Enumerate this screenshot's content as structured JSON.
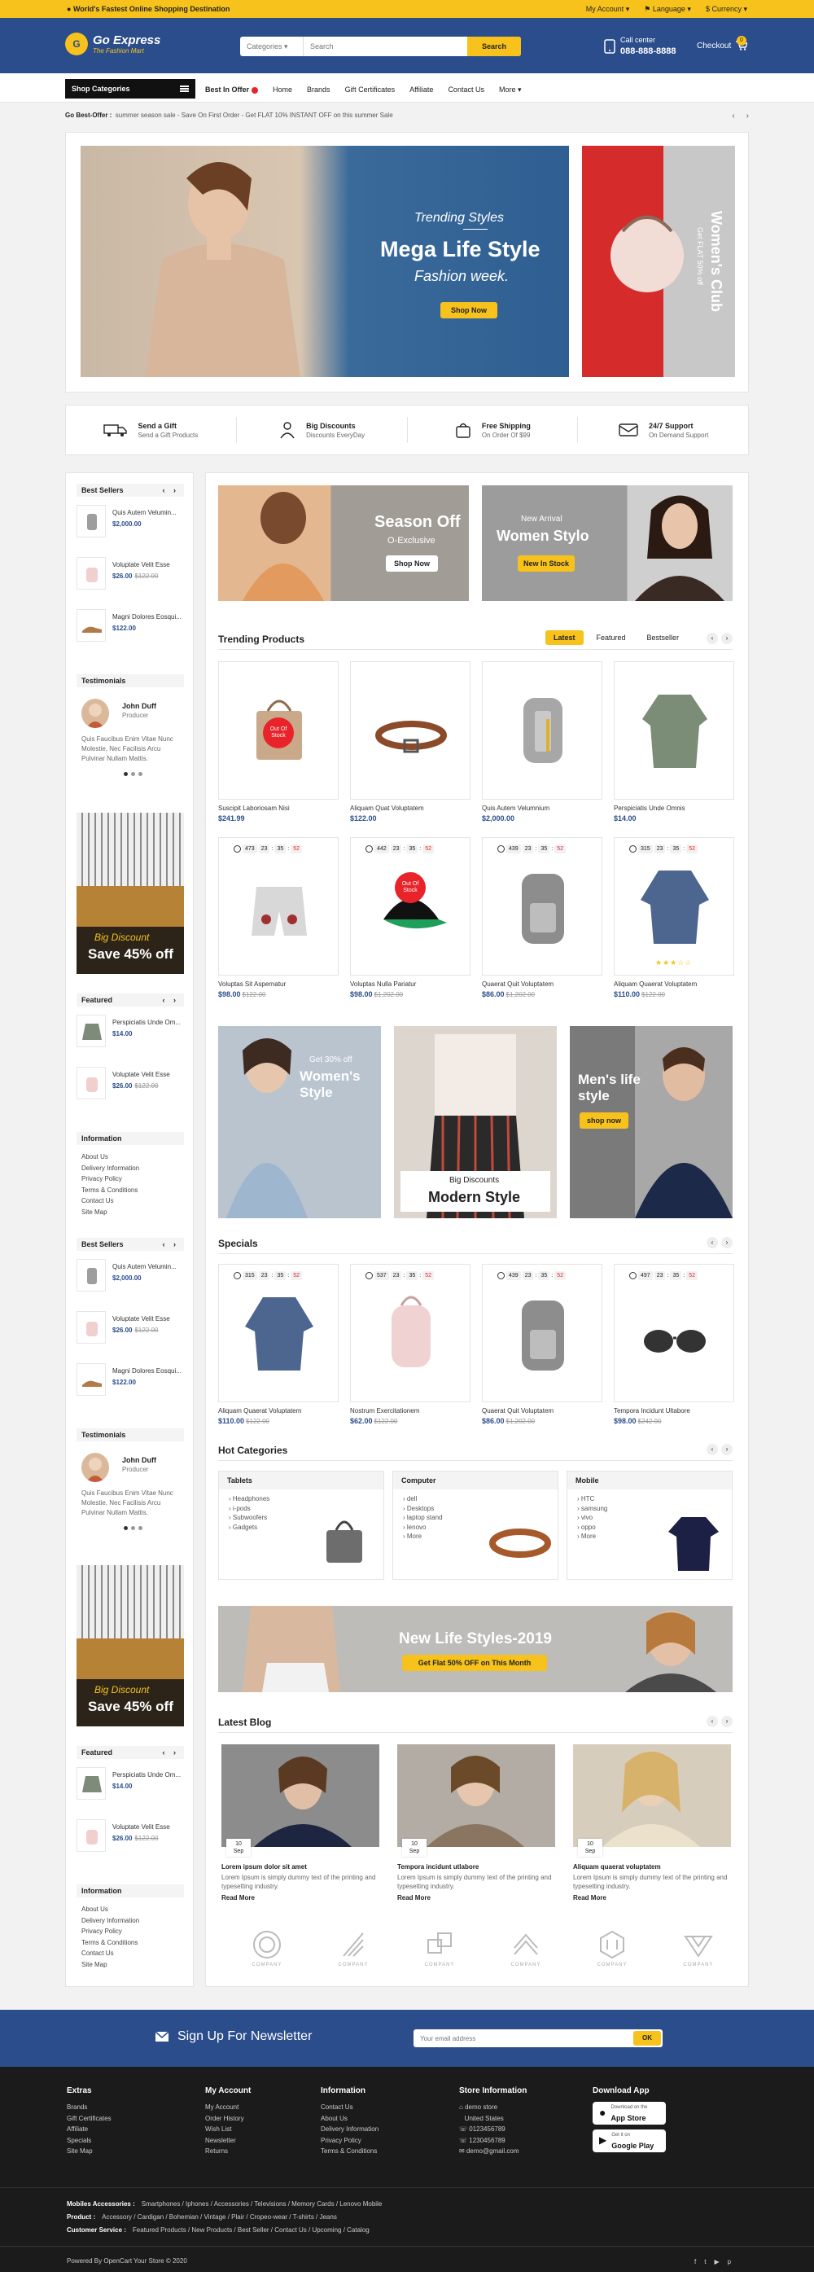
{
  "topbar": {
    "tagline": "World's Fastest Online Shopping Destination",
    "my_account": "My Account",
    "language": "Language",
    "currency": "Currency"
  },
  "header": {
    "logo_title": "Go Express",
    "logo_sub": "The Fashion Mart",
    "search_category": "Categories",
    "search_placeholder": "Search",
    "search_button": "Search",
    "call_label": "Call center",
    "call_number": "088-888-8888",
    "checkout": "Checkout",
    "cart_count": "0"
  },
  "nav": {
    "shop_categories": "Shop Categories",
    "links": [
      "Best In Offer",
      "Home",
      "Brands",
      "Gift Certificates",
      "Affiliate",
      "Contact Us",
      "More"
    ]
  },
  "offer": {
    "label": "Go Best-Offer :",
    "text": "summer season sale - Save On First Order - Get FLAT 10% INSTANT OFF on this summer Sale"
  },
  "hero": {
    "kicker": "Trending Styles",
    "title": "Mega Life Style",
    "subtitle": "Fashion week.",
    "button": "Shop Now",
    "side_title": "Women's Club",
    "side_sub": "Get FLAT 50% off"
  },
  "services": [
    {
      "title": "Send a Gift",
      "sub": "Send a Gift Products",
      "icon": "truck-icon"
    },
    {
      "title": "Big Discounts",
      "sub": "Discounts EveryDay",
      "icon": "discount-person-icon"
    },
    {
      "title": "Free Shipping",
      "sub": "On Order Of $99",
      "icon": "bag-icon"
    },
    {
      "title": "24/7 Support",
      "sub": "On Demand Support",
      "icon": "support-icon"
    }
  ],
  "sidebar": {
    "best_sellers_title": "Best Sellers",
    "best_sellers": [
      {
        "name": "Quis Autem Velumin...",
        "price": "$2,000.00",
        "old": ""
      },
      {
        "name": "Voluptate Velit Esse",
        "price": "$26.00",
        "old": "$122.00"
      },
      {
        "name": "Magni Dolores Eosqui...",
        "price": "$122.00",
        "old": ""
      }
    ],
    "testimonials_title": "Testimonials",
    "testimonial": {
      "name": "John Duff",
      "role": "Producer",
      "text": "Quis Faucibus Enim Vitae Nunc Molestie, Nec Facilisis Arcu Pulvinar Nullam Mattis."
    },
    "banner_script": "Big Discount",
    "banner_text": "Save 45% off",
    "featured_title": "Featured",
    "featured": [
      {
        "name": "Perspiciatis Unde Om...",
        "price": "$14.00",
        "old": ""
      },
      {
        "name": "Voluptate Velit Esse",
        "price": "$26.00",
        "old": "$122.00"
      }
    ],
    "information_title": "Information",
    "information": [
      "About Us",
      "Delivery Information",
      "Privacy Policy",
      "Terms & Conditions",
      "Contact Us",
      "Site Map"
    ]
  },
  "promo": {
    "season_title": "Season Off",
    "season_sub": "O-Exclusive",
    "season_btn": "Shop Now",
    "new_arrival": "New Arrival",
    "women_stylo": "Women Stylo",
    "in_stock": "New In Stock"
  },
  "trending": {
    "title": "Trending Products",
    "tabs": [
      "Latest",
      "Featured",
      "Bestseller"
    ],
    "products": [
      {
        "name": "Suscipit Laboriosam Nisi",
        "price": "$241.99",
        "old": "",
        "timer": null,
        "oos": true,
        "icon": "box-bag-icon"
      },
      {
        "name": "Aliquam Quat Voluptatem",
        "price": "$122.00",
        "old": "",
        "timer": null,
        "oos": false,
        "icon": "belt-icon"
      },
      {
        "name": "Quis Autem Velumnium",
        "price": "$2,000.00",
        "old": "",
        "timer": null,
        "oos": false,
        "icon": "backpack-icon"
      },
      {
        "name": "Perspiciatis Unde Omnis",
        "price": "$14.00",
        "old": "",
        "timer": null,
        "oos": false,
        "icon": "jacket-icon"
      },
      {
        "name": "Voluptas Sit Aspernatur",
        "price": "$98.00",
        "old": "$122.00",
        "timer": [
          "473",
          "23",
          "35",
          "52"
        ],
        "oos": false,
        "icon": "shorts-icon"
      },
      {
        "name": "Voluptas Nulla Pariatur",
        "price": "$98.00",
        "old": "$1,202.00",
        "timer": [
          "442",
          "23",
          "35",
          "52"
        ],
        "oos": true,
        "icon": "cap-icon"
      },
      {
        "name": "Quaerat Quit Voluptatem",
        "price": "$86.00",
        "old": "$1,202.00",
        "timer": [
          "439",
          "23",
          "35",
          "52"
        ],
        "oos": false,
        "icon": "backpack-icon"
      },
      {
        "name": "Aliquam Quaerat Voluptatem",
        "price": "$110.00",
        "old": "$122.00",
        "timer": [
          "315",
          "23",
          "35",
          "52"
        ],
        "oos": false,
        "icon": "sweater-icon"
      }
    ],
    "oos_label": "Out Of Stock"
  },
  "banners2": {
    "w_top": "Get 30% off",
    "w_title": "Women's Style",
    "m_small": "Big Discounts",
    "m_title": "Modern Style",
    "men_title": "Men's life style",
    "men_btn": "shop now"
  },
  "specials": {
    "title": "Specials",
    "products": [
      {
        "name": "Aliquam Quaerat Voluptatem",
        "price": "$110.00",
        "old": "$122.00",
        "timer": [
          "315",
          "23",
          "35",
          "52"
        ],
        "icon": "sweater-icon"
      },
      {
        "name": "Nostrum Exercitationem",
        "price": "$62.00",
        "old": "$122.00",
        "timer": [
          "537",
          "23",
          "35",
          "52"
        ],
        "icon": "pink-backpack-icon"
      },
      {
        "name": "Quaerat Quit Voluptatem",
        "price": "$86.00",
        "old": "$1,202.00",
        "timer": [
          "439",
          "23",
          "35",
          "52"
        ],
        "icon": "backpack-icon"
      },
      {
        "name": "Tempora Incidunt Ultabore",
        "price": "$98.00",
        "old": "$242.00",
        "timer": [
          "497",
          "23",
          "35",
          "52"
        ],
        "icon": "sunglasses-icon"
      }
    ]
  },
  "hot": {
    "title": "Hot Categories",
    "cats": [
      {
        "title": "Tablets",
        "items": [
          "Headphones",
          "i-pods",
          "Subwoofers",
          "Gadgets"
        ],
        "icon": "handbag-icon"
      },
      {
        "title": "Computer",
        "items": [
          "dell",
          "Desktops",
          "laptop stand",
          "lenovo",
          "More"
        ],
        "icon": "belt-icon"
      },
      {
        "title": "Mobile",
        "items": [
          "HTC",
          "samsung",
          "vivo",
          "oppo",
          "More"
        ],
        "icon": "tshirt-icon"
      }
    ]
  },
  "lifestyle": {
    "title": "New Life Styles-2019",
    "button": "Get Flat 50% OFF on This Month"
  },
  "blog": {
    "title": "Latest Blog",
    "posts": [
      {
        "day": "10",
        "month": "Sep",
        "title": "Lorem ipsum dolor sit amet",
        "text": "Lorem Ipsum is simply dummy text of the printing and typesetting industry.",
        "more": "Read More"
      },
      {
        "day": "10",
        "month": "Sep",
        "title": "Tempora incidunt utlabore",
        "text": "Lorem Ipsum is simply dummy text of the printing and typesetting industry.",
        "more": "Read More"
      },
      {
        "day": "10",
        "month": "Sep",
        "title": "Aliquam quaerat voluptatem",
        "text": "Lorem Ipsum is simply dummy text of the printing and typesetting industry.",
        "more": "Read More"
      }
    ]
  },
  "brands": [
    "COMPANY",
    "COMPANY",
    "COMPANY",
    "COMPANY",
    "COMPANY",
    "COMPANY"
  ],
  "newsletter": {
    "label": "Sign Up For Newsletter",
    "placeholder": "Your email address",
    "button": "OK"
  },
  "footer": {
    "extras_title": "Extras",
    "extras": [
      "Brands",
      "Gift Certificates",
      "Affiliate",
      "Specials",
      "Site Map"
    ],
    "account_title": "My Account",
    "account": [
      "My Account",
      "Order History",
      "Wish List",
      "Newsletter",
      "Returns"
    ],
    "info_title": "Information",
    "info": [
      "Contact Us",
      "About Us",
      "Delivery Information",
      "Privacy Policy",
      "Terms & Conditions"
    ],
    "store_title": "Store Information",
    "store": [
      "demo store",
      "United States",
      "0123456789",
      "1230456789",
      "demo@gmail.com"
    ],
    "app_title": "Download App",
    "appstore_small": "Download on the",
    "appstore": "App Store",
    "play_small": "Get it on",
    "play": "Google Play",
    "row1_label": "Mobiles Accessories :",
    "row1": "Smartphones / Iphones / Accessories / Televisions / Memory Cards / Lenovo Mobile",
    "row2_label": "Product :",
    "row2": "Accessory / Cardigan / Bohemian / Vintage / Plair / Cropeo-wear / T-shirts / Jeans",
    "row3_label": "Customer Service :",
    "row3": "Featured Products / New Products / Best Seller / Contact Us / Upcoming / Catalog",
    "powered": "Powered By OpenCart Your Store © 2020"
  },
  "colors": {
    "accent": "#f6c21b",
    "brand": "#2b4d8c",
    "sale": "#e8242a"
  }
}
